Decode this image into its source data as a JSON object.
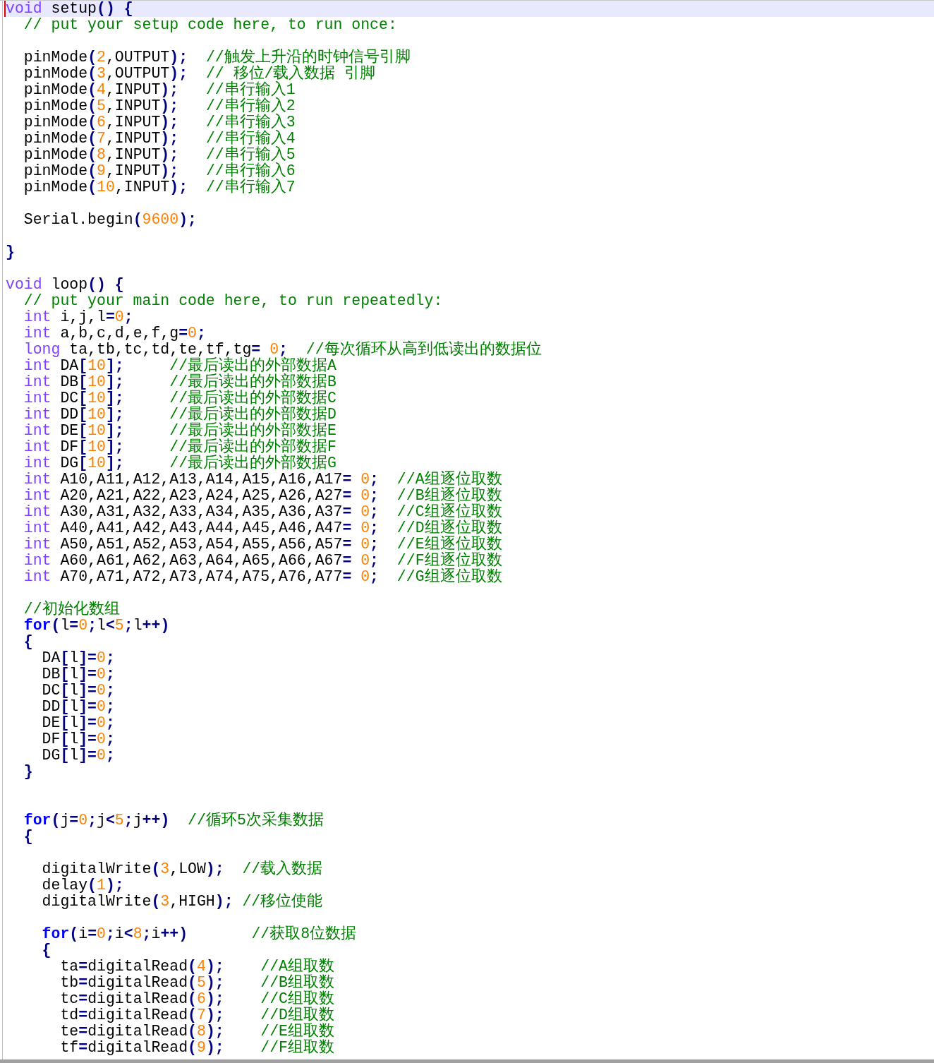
{
  "editor": {
    "lines": [
      {
        "current": true,
        "tokens": [
          {
            "kind": "type",
            "text": "void"
          },
          {
            "kind": "plain",
            "text": " setup() {"
          }
        ]
      },
      {
        "current": false,
        "tokens": [
          {
            "kind": "comment",
            "text": "  // put your setup code here, to run once:"
          }
        ]
      },
      {
        "current": false
      },
      {
        "current": false,
        "tokens": [
          {
            "kind": "plain",
            "text": "  pinMode("
          },
          {
            "kind": "number",
            "text": "2"
          },
          {
            "kind": "plain",
            "text": ",OUTPUT);  "
          },
          {
            "kind": "comment",
            "text": "//触发上升沿的时钟信号引脚"
          }
        ]
      },
      {
        "current": false,
        "tokens": [
          {
            "kind": "plain",
            "text": "  pinMode("
          },
          {
            "kind": "number",
            "text": "3"
          },
          {
            "kind": "plain",
            "text": ",OUTPUT);  "
          },
          {
            "kind": "comment",
            "text": "// 移位/载入数据 引脚"
          }
        ]
      },
      {
        "current": false,
        "tokens": [
          {
            "kind": "plain",
            "text": "  pinMode("
          },
          {
            "kind": "number",
            "text": "4"
          },
          {
            "kind": "plain",
            "text": ",INPUT);   "
          },
          {
            "kind": "comment",
            "text": "//串行输入1"
          }
        ]
      },
      {
        "current": false,
        "tokens": [
          {
            "kind": "plain",
            "text": "  pinMode("
          },
          {
            "kind": "number",
            "text": "5"
          },
          {
            "kind": "plain",
            "text": ",INPUT);   "
          },
          {
            "kind": "comment",
            "text": "//串行输入2"
          }
        ]
      },
      {
        "current": false,
        "tokens": [
          {
            "kind": "plain",
            "text": "  pinMode("
          },
          {
            "kind": "number",
            "text": "6"
          },
          {
            "kind": "plain",
            "text": ",INPUT);   "
          },
          {
            "kind": "comment",
            "text": "//串行输入3"
          }
        ]
      },
      {
        "current": false,
        "tokens": [
          {
            "kind": "plain",
            "text": "  pinMode("
          },
          {
            "kind": "number",
            "text": "7"
          },
          {
            "kind": "plain",
            "text": ",INPUT);   "
          },
          {
            "kind": "comment",
            "text": "//串行输入4"
          }
        ]
      },
      {
        "current": false,
        "tokens": [
          {
            "kind": "plain",
            "text": "  pinMode("
          },
          {
            "kind": "number",
            "text": "8"
          },
          {
            "kind": "plain",
            "text": ",INPUT);   "
          },
          {
            "kind": "comment",
            "text": "//串行输入5"
          }
        ]
      },
      {
        "current": false,
        "tokens": [
          {
            "kind": "plain",
            "text": "  pinMode("
          },
          {
            "kind": "number",
            "text": "9"
          },
          {
            "kind": "plain",
            "text": ",INPUT);   "
          },
          {
            "kind": "comment",
            "text": "//串行输入6"
          }
        ]
      },
      {
        "current": false,
        "tokens": [
          {
            "kind": "plain",
            "text": "  pinMode("
          },
          {
            "kind": "number",
            "text": "10"
          },
          {
            "kind": "plain",
            "text": ",INPUT);  "
          },
          {
            "kind": "comment",
            "text": "//串行输入7"
          }
        ]
      },
      {
        "current": false
      },
      {
        "current": false,
        "tokens": [
          {
            "kind": "plain",
            "text": "  Serial.begin("
          },
          {
            "kind": "number",
            "text": "9600"
          },
          {
            "kind": "plain",
            "text": ");"
          }
        ]
      },
      {
        "current": false
      },
      {
        "current": false,
        "tokens": [
          {
            "kind": "plain",
            "text": "}"
          }
        ]
      },
      {
        "current": false
      },
      {
        "current": false,
        "tokens": [
          {
            "kind": "type",
            "text": "void"
          },
          {
            "kind": "plain",
            "text": " loop() {"
          }
        ]
      },
      {
        "current": false,
        "tokens": [
          {
            "kind": "comment",
            "text": "  // put your main code here, to run repeatedly:"
          }
        ]
      },
      {
        "current": false,
        "tokens": [
          {
            "kind": "type",
            "text": "  int"
          },
          {
            "kind": "plain",
            "text": " i,j,l="
          },
          {
            "kind": "number",
            "text": "0"
          },
          {
            "kind": "plain",
            "text": ";"
          }
        ]
      },
      {
        "current": false,
        "tokens": [
          {
            "kind": "type",
            "text": "  int"
          },
          {
            "kind": "plain",
            "text": " a,b,c,d,e,f,g="
          },
          {
            "kind": "number",
            "text": "0"
          },
          {
            "kind": "plain",
            "text": ";"
          }
        ]
      },
      {
        "current": false,
        "tokens": [
          {
            "kind": "type",
            "text": "  long"
          },
          {
            "kind": "plain",
            "text": " ta,tb,tc,td,te,tf,tg= "
          },
          {
            "kind": "number",
            "text": "0"
          },
          {
            "kind": "plain",
            "text": ";  "
          },
          {
            "kind": "comment",
            "text": "//每次循环从高到低读出的数据位"
          }
        ]
      },
      {
        "current": false,
        "tokens": [
          {
            "kind": "type",
            "text": "  int"
          },
          {
            "kind": "plain",
            "text": " DA["
          },
          {
            "kind": "number",
            "text": "10"
          },
          {
            "kind": "plain",
            "text": "];     "
          },
          {
            "kind": "comment",
            "text": "//最后读出的外部数据A"
          }
        ]
      },
      {
        "current": false,
        "tokens": [
          {
            "kind": "type",
            "text": "  int"
          },
          {
            "kind": "plain",
            "text": " DB["
          },
          {
            "kind": "number",
            "text": "10"
          },
          {
            "kind": "plain",
            "text": "];     "
          },
          {
            "kind": "comment",
            "text": "//最后读出的外部数据B"
          }
        ]
      },
      {
        "current": false,
        "tokens": [
          {
            "kind": "type",
            "text": "  int"
          },
          {
            "kind": "plain",
            "text": " DC["
          },
          {
            "kind": "number",
            "text": "10"
          },
          {
            "kind": "plain",
            "text": "];     "
          },
          {
            "kind": "comment",
            "text": "//最后读出的外部数据C"
          }
        ]
      },
      {
        "current": false,
        "tokens": [
          {
            "kind": "type",
            "text": "  int"
          },
          {
            "kind": "plain",
            "text": " DD["
          },
          {
            "kind": "number",
            "text": "10"
          },
          {
            "kind": "plain",
            "text": "];     "
          },
          {
            "kind": "comment",
            "text": "//最后读出的外部数据D"
          }
        ]
      },
      {
        "current": false,
        "tokens": [
          {
            "kind": "type",
            "text": "  int"
          },
          {
            "kind": "plain",
            "text": " DE["
          },
          {
            "kind": "number",
            "text": "10"
          },
          {
            "kind": "plain",
            "text": "];     "
          },
          {
            "kind": "comment",
            "text": "//最后读出的外部数据E"
          }
        ]
      },
      {
        "current": false,
        "tokens": [
          {
            "kind": "type",
            "text": "  int"
          },
          {
            "kind": "plain",
            "text": " DF["
          },
          {
            "kind": "number",
            "text": "10"
          },
          {
            "kind": "plain",
            "text": "];     "
          },
          {
            "kind": "comment",
            "text": "//最后读出的外部数据F"
          }
        ]
      },
      {
        "current": false,
        "tokens": [
          {
            "kind": "type",
            "text": "  int"
          },
          {
            "kind": "plain",
            "text": " DG["
          },
          {
            "kind": "number",
            "text": "10"
          },
          {
            "kind": "plain",
            "text": "];     "
          },
          {
            "kind": "comment",
            "text": "//最后读出的外部数据G"
          }
        ]
      },
      {
        "current": false,
        "tokens": [
          {
            "kind": "type",
            "text": "  int"
          },
          {
            "kind": "plain",
            "text": " A10,A11,A12,A13,A14,A15,A16,A17= "
          },
          {
            "kind": "number",
            "text": "0"
          },
          {
            "kind": "plain",
            "text": ";  "
          },
          {
            "kind": "comment",
            "text": "//A组逐位取数"
          }
        ]
      },
      {
        "current": false,
        "tokens": [
          {
            "kind": "type",
            "text": "  int"
          },
          {
            "kind": "plain",
            "text": " A20,A21,A22,A23,A24,A25,A26,A27= "
          },
          {
            "kind": "number",
            "text": "0"
          },
          {
            "kind": "plain",
            "text": ";  "
          },
          {
            "kind": "comment",
            "text": "//B组逐位取数"
          }
        ]
      },
      {
        "current": false,
        "tokens": [
          {
            "kind": "type",
            "text": "  int"
          },
          {
            "kind": "plain",
            "text": " A30,A31,A32,A33,A34,A35,A36,A37= "
          },
          {
            "kind": "number",
            "text": "0"
          },
          {
            "kind": "plain",
            "text": ";  "
          },
          {
            "kind": "comment",
            "text": "//C组逐位取数"
          }
        ]
      },
      {
        "current": false,
        "tokens": [
          {
            "kind": "type",
            "text": "  int"
          },
          {
            "kind": "plain",
            "text": " A40,A41,A42,A43,A44,A45,A46,A47= "
          },
          {
            "kind": "number",
            "text": "0"
          },
          {
            "kind": "plain",
            "text": ";  "
          },
          {
            "kind": "comment",
            "text": "//D组逐位取数"
          }
        ]
      },
      {
        "current": false,
        "tokens": [
          {
            "kind": "type",
            "text": "  int"
          },
          {
            "kind": "plain",
            "text": " A50,A51,A52,A53,A54,A55,A56,A57= "
          },
          {
            "kind": "number",
            "text": "0"
          },
          {
            "kind": "plain",
            "text": ";  "
          },
          {
            "kind": "comment",
            "text": "//E组逐位取数"
          }
        ]
      },
      {
        "current": false,
        "tokens": [
          {
            "kind": "type",
            "text": "  int"
          },
          {
            "kind": "plain",
            "text": " A60,A61,A62,A63,A64,A65,A66,A67= "
          },
          {
            "kind": "number",
            "text": "0"
          },
          {
            "kind": "plain",
            "text": ";  "
          },
          {
            "kind": "comment",
            "text": "//F组逐位取数"
          }
        ]
      },
      {
        "current": false,
        "tokens": [
          {
            "kind": "type",
            "text": "  int"
          },
          {
            "kind": "plain",
            "text": " A70,A71,A72,A73,A74,A75,A76,A77= "
          },
          {
            "kind": "number",
            "text": "0"
          },
          {
            "kind": "plain",
            "text": ";  "
          },
          {
            "kind": "comment",
            "text": "//G组逐位取数"
          }
        ]
      },
      {
        "current": false
      },
      {
        "current": false,
        "tokens": [
          {
            "kind": "comment",
            "text": "  //初始化数组"
          }
        ]
      },
      {
        "current": false,
        "tokens": [
          {
            "kind": "keyword",
            "text": "  for"
          },
          {
            "kind": "plain",
            "text": "(l="
          },
          {
            "kind": "number",
            "text": "0"
          },
          {
            "kind": "plain",
            "text": ";l<"
          },
          {
            "kind": "number",
            "text": "5"
          },
          {
            "kind": "plain",
            "text": ";l++)"
          }
        ]
      },
      {
        "current": false,
        "tokens": [
          {
            "kind": "plain",
            "text": "  {"
          }
        ]
      },
      {
        "current": false,
        "tokens": [
          {
            "kind": "plain",
            "text": "    DA[l]="
          },
          {
            "kind": "number",
            "text": "0"
          },
          {
            "kind": "plain",
            "text": ";"
          }
        ]
      },
      {
        "current": false,
        "tokens": [
          {
            "kind": "plain",
            "text": "    DB[l]="
          },
          {
            "kind": "number",
            "text": "0"
          },
          {
            "kind": "plain",
            "text": ";"
          }
        ]
      },
      {
        "current": false,
        "tokens": [
          {
            "kind": "plain",
            "text": "    DC[l]="
          },
          {
            "kind": "number",
            "text": "0"
          },
          {
            "kind": "plain",
            "text": ";"
          }
        ]
      },
      {
        "current": false,
        "tokens": [
          {
            "kind": "plain",
            "text": "    DD[l]="
          },
          {
            "kind": "number",
            "text": "0"
          },
          {
            "kind": "plain",
            "text": ";"
          }
        ]
      },
      {
        "current": false,
        "tokens": [
          {
            "kind": "plain",
            "text": "    DE[l]="
          },
          {
            "kind": "number",
            "text": "0"
          },
          {
            "kind": "plain",
            "text": ";"
          }
        ]
      },
      {
        "current": false,
        "tokens": [
          {
            "kind": "plain",
            "text": "    DF[l]="
          },
          {
            "kind": "number",
            "text": "0"
          },
          {
            "kind": "plain",
            "text": ";"
          }
        ]
      },
      {
        "current": false,
        "tokens": [
          {
            "kind": "plain",
            "text": "    DG[l]="
          },
          {
            "kind": "number",
            "text": "0"
          },
          {
            "kind": "plain",
            "text": ";"
          }
        ]
      },
      {
        "current": false,
        "tokens": [
          {
            "kind": "plain",
            "text": "  }"
          }
        ]
      },
      {
        "current": false
      },
      {
        "current": false
      },
      {
        "current": false,
        "tokens": [
          {
            "kind": "keyword",
            "text": "  for"
          },
          {
            "kind": "plain",
            "text": "(j="
          },
          {
            "kind": "number",
            "text": "0"
          },
          {
            "kind": "plain",
            "text": ";j<"
          },
          {
            "kind": "number",
            "text": "5"
          },
          {
            "kind": "plain",
            "text": ";j++)  "
          },
          {
            "kind": "comment",
            "text": "//循环5次采集数据"
          }
        ]
      },
      {
        "current": false,
        "tokens": [
          {
            "kind": "plain",
            "text": "  {"
          }
        ]
      },
      {
        "current": false
      },
      {
        "current": false,
        "tokens": [
          {
            "kind": "plain",
            "text": "    digitalWrite("
          },
          {
            "kind": "number",
            "text": "3"
          },
          {
            "kind": "plain",
            "text": ",LOW);  "
          },
          {
            "kind": "comment",
            "text": "//载入数据"
          }
        ]
      },
      {
        "current": false,
        "tokens": [
          {
            "kind": "plain",
            "text": "    delay("
          },
          {
            "kind": "number",
            "text": "1"
          },
          {
            "kind": "plain",
            "text": ");"
          }
        ]
      },
      {
        "current": false,
        "tokens": [
          {
            "kind": "plain",
            "text": "    digitalWrite("
          },
          {
            "kind": "number",
            "text": "3"
          },
          {
            "kind": "plain",
            "text": ",HIGH); "
          },
          {
            "kind": "comment",
            "text": "//移位使能"
          }
        ]
      },
      {
        "current": false
      },
      {
        "current": false,
        "tokens": [
          {
            "kind": "keyword",
            "text": "    for"
          },
          {
            "kind": "plain",
            "text": "(i="
          },
          {
            "kind": "number",
            "text": "0"
          },
          {
            "kind": "plain",
            "text": ";i<"
          },
          {
            "kind": "number",
            "text": "8"
          },
          {
            "kind": "plain",
            "text": ";i++)       "
          },
          {
            "kind": "comment",
            "text": "//获取8位数据"
          }
        ]
      },
      {
        "current": false,
        "tokens": [
          {
            "kind": "plain",
            "text": "    {"
          }
        ]
      },
      {
        "current": false,
        "tokens": [
          {
            "kind": "plain",
            "text": "      ta=digitalRead("
          },
          {
            "kind": "number",
            "text": "4"
          },
          {
            "kind": "plain",
            "text": ");    "
          },
          {
            "kind": "comment",
            "text": "//A组取数"
          }
        ]
      },
      {
        "current": false,
        "tokens": [
          {
            "kind": "plain",
            "text": "      tb=digitalRead("
          },
          {
            "kind": "number",
            "text": "5"
          },
          {
            "kind": "plain",
            "text": ");    "
          },
          {
            "kind": "comment",
            "text": "//B组取数"
          }
        ]
      },
      {
        "current": false,
        "tokens": [
          {
            "kind": "plain",
            "text": "      tc=digitalRead("
          },
          {
            "kind": "number",
            "text": "6"
          },
          {
            "kind": "plain",
            "text": ");    "
          },
          {
            "kind": "comment",
            "text": "//C组取数"
          }
        ]
      },
      {
        "current": false,
        "tokens": [
          {
            "kind": "plain",
            "text": "      td=digitalRead("
          },
          {
            "kind": "number",
            "text": "7"
          },
          {
            "kind": "plain",
            "text": ");    "
          },
          {
            "kind": "comment",
            "text": "//D组取数"
          }
        ]
      },
      {
        "current": false,
        "tokens": [
          {
            "kind": "plain",
            "text": "      te=digitalRead("
          },
          {
            "kind": "number",
            "text": "8"
          },
          {
            "kind": "plain",
            "text": ");    "
          },
          {
            "kind": "comment",
            "text": "//E组取数"
          }
        ]
      },
      {
        "current": false,
        "tokens": [
          {
            "kind": "plain",
            "text": "      tf=digitalRead("
          },
          {
            "kind": "number",
            "text": "9"
          },
          {
            "kind": "plain",
            "text": ");    "
          },
          {
            "kind": "comment",
            "text": "//F组取数"
          }
        ]
      }
    ]
  }
}
